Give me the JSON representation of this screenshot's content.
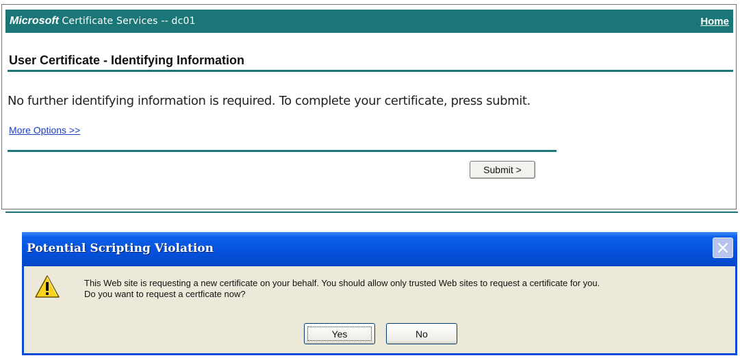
{
  "web_page": {
    "header": {
      "brand": "Microsoft",
      "service": "Certificate Services",
      "separator": "--",
      "server": "dc01",
      "home_link": "Home"
    },
    "title": "User Certificate - Identifying Information",
    "message": "No further identifying information is required. To complete your certificate, press submit.",
    "more_options_link": "More Options >>",
    "submit_label": "Submit >"
  },
  "dialog": {
    "title": "Potential Scripting Violation",
    "icon": "warning-icon",
    "message_line1": "This Web site is requesting a new certificate on your behalf. You should allow only trusted Web sites to request a certificate for you.",
    "message_line2": "Do you want to request a certficate now?",
    "yes_label": "Yes",
    "no_label": "No"
  },
  "colors": {
    "header_teal": "#1b7777",
    "link_blue": "#1a3fc0",
    "xp_title_blue": "#0550dc",
    "dialog_face": "#ece9d8"
  }
}
